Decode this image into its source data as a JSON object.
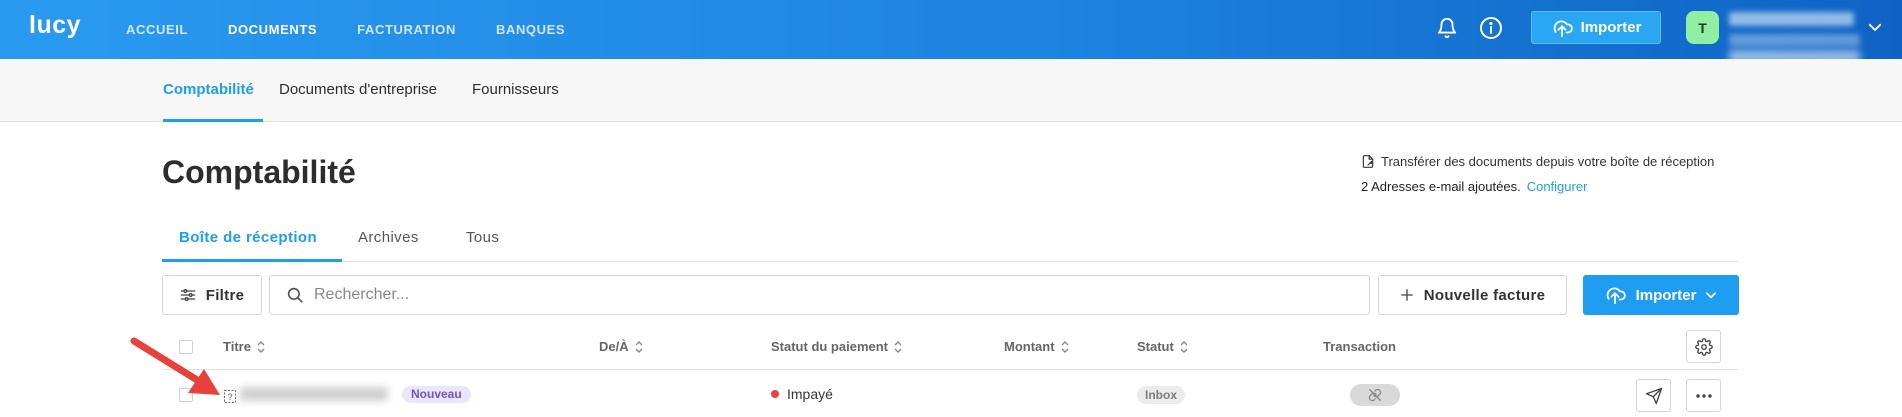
{
  "topbar": {
    "logo": "lucy",
    "nav": [
      "ACCUEIL",
      "DOCUMENTS",
      "FACTURATION",
      "BANQUES"
    ],
    "active_nav": "DOCUMENTS",
    "import_label": "Importer",
    "avatar_initial": "T",
    "icons": [
      "bell-icon",
      "info-icon",
      "upload-cloud-icon",
      "chevron-down-icon"
    ]
  },
  "subnav": {
    "items": [
      "Comptabilité",
      "Documents d'entreprise",
      "Fournisseurs"
    ],
    "active": "Comptabilité"
  },
  "page": {
    "title": "Comptabilité",
    "transfer_text": "Transférer des documents depuis votre boîte de réception",
    "addresses_text": "2 Adresses e-mail ajoutées.",
    "configure_label": "Configurer"
  },
  "tabs": {
    "items": [
      "Boîte de réception",
      "Archives",
      "Tous"
    ],
    "active": "Boîte de réception"
  },
  "toolbar": {
    "filter_label": "Filtre",
    "search_placeholder": "Rechercher...",
    "new_invoice_label": "Nouvelle facture",
    "import_label": "Importer"
  },
  "table": {
    "columns": [
      "Titre",
      "De/À",
      "Statut du paiement",
      "Montant",
      "Statut",
      "Transaction"
    ],
    "rows": [
      {
        "badge": "Nouveau",
        "payment_status": "Impayé",
        "payment_status_color": "#e84343",
        "status": "Inbox"
      }
    ]
  },
  "colors": {
    "accent": "#1f9df0",
    "topbar_start": "#2a9af0",
    "topbar_end": "#0f63c4",
    "annotation_arrow": "#e8403a"
  }
}
